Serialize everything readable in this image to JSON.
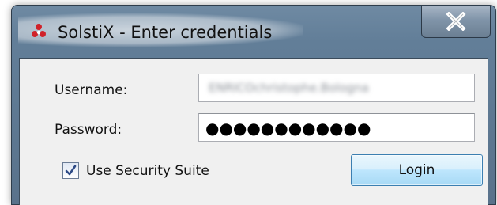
{
  "window": {
    "title": "SolstiX - Enter credentials",
    "app_icon": "solstix-logo-icon",
    "close_label": "X"
  },
  "form": {
    "username_label": "Username:",
    "username_value": "ENRICOchristophe.Bologna",
    "password_label": "Password:",
    "password_value": "●●●●●●●●●●●●",
    "checkbox_label": "Use Security Suite",
    "checkbox_checked": true,
    "login_label": "Login"
  }
}
